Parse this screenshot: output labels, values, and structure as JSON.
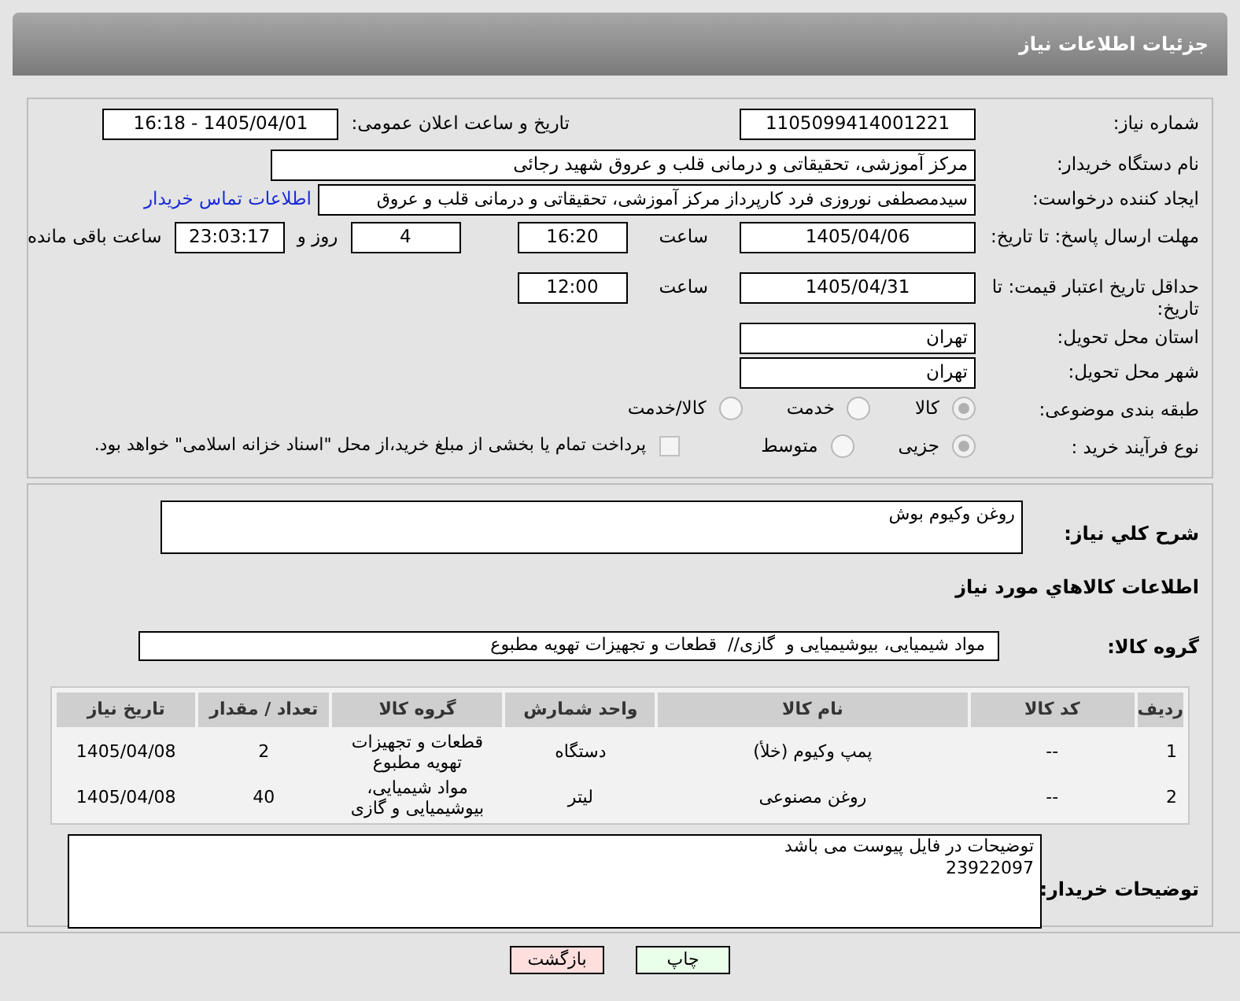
{
  "header": {
    "title": "جزئیات اطلاعات نیاز"
  },
  "need_number": {
    "label": "شماره نیاز:",
    "value": "1105099414001221"
  },
  "announce": {
    "label": "تاریخ و ساعت اعلان عمومی:",
    "value": "1405/04/01 - 16:18"
  },
  "buyer": {
    "label": "نام دستگاه خریدار:",
    "value": "مرکز آموزشی، تحقیقاتی و درمانی قلب و عروق شهید رجائی"
  },
  "creator": {
    "label": "ایجاد کننده درخواست:",
    "value": "سیدمصطفی نوروزی فرد کارپرداز مرکز آموزشی، تحقیقاتی و درمانی قلب و عروق",
    "link": "اطلاعات تماس خریدار"
  },
  "deadline": {
    "label": "مهلت ارسال پاسخ: تا تاریخ:",
    "date": "1405/04/06",
    "time_label": "ساعت",
    "time": "16:20",
    "days": "4",
    "days_label": "روز و",
    "remaining": "23:03:17",
    "remaining_label": "ساعت باقی مانده"
  },
  "validity": {
    "label": "حداقل تاریخ اعتبار قیمت: تا تاریخ:",
    "date": "1405/04/31",
    "time_label": "ساعت",
    "time": "12:00"
  },
  "province": {
    "label": "استان محل تحویل:",
    "value": "تهران"
  },
  "city": {
    "label": "شهر محل تحویل:",
    "value": "تهران"
  },
  "category": {
    "label": "طبقه بندی موضوعی:",
    "options": [
      {
        "label": "کالا",
        "selected": true
      },
      {
        "label": "خدمت",
        "selected": false
      },
      {
        "label": "کالا/خدمت",
        "selected": false
      }
    ]
  },
  "process": {
    "label": "نوع فرآیند خرید :",
    "options": [
      {
        "label": "جزیی",
        "selected": true
      },
      {
        "label": "متوسط",
        "selected": false
      }
    ],
    "payment": {
      "checked": false,
      "label": "پرداخت تمام یا بخشی از مبلغ خرید،از محل \"اسناد خزانه اسلامی\" خواهد بود."
    }
  },
  "summary": {
    "label": "شرح کلي نياز:",
    "value": "روغن وکیوم بوش"
  },
  "goods_title": "اطلاعات کالاهاي مورد نياز",
  "goods_group": {
    "label": "گروه کالا:",
    "value": "مواد شیمیایی، بیوشیمیایی و  گازی//  قطعات و تجهیزات تهویه مطبوع"
  },
  "table": {
    "columns": [
      "ردیف",
      "کد کالا",
      "نام کالا",
      "واحد شمارش",
      "گروه کالا",
      "تعداد / مقدار",
      "تاریخ نیاز"
    ],
    "rows": [
      [
        "1",
        "--",
        "پمپ وکیوم (خلأ)",
        "دستگاه",
        "قطعات و تجهیزات تهویه مطبوع",
        "2",
        "1405/04/08"
      ],
      [
        "2",
        "--",
        "روغن مصنوعی",
        "لیتر",
        "مواد شیمیایی، بیوشیمیایی و گازی",
        "40",
        "1405/04/08"
      ]
    ]
  },
  "notes": {
    "label": "توضیحات خریدار:",
    "lines": [
      "توضیحات در فایل پیوست می باشد",
      "23922097"
    ]
  },
  "buttons": [
    {
      "label": "چاپ",
      "kind": "print"
    },
    {
      "label": "بازگشت",
      "kind": "back"
    }
  ]
}
